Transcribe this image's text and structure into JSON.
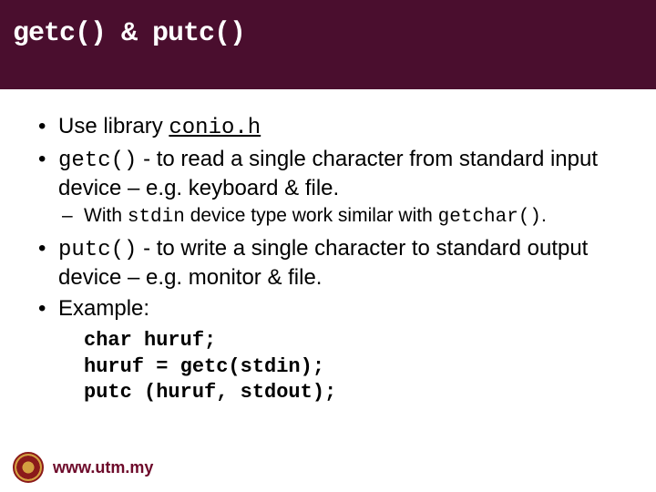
{
  "title": "getc() & putc()",
  "bullets": {
    "b1": {
      "pre": "Use library ",
      "code": "conio.h"
    },
    "b2": {
      "code": "getc()",
      "post": " - to read a single character from standard input device – e.g. keyboard & file."
    },
    "b2sub": {
      "pre": "With ",
      "code1": "stdin",
      "mid": " device type work similar with ",
      "code2": "getchar()",
      "post": "."
    },
    "b3": {
      "code": "putc()",
      "post": " - to write a single character to standard output device – e.g. monitor & file."
    },
    "b4": {
      "text": "Example:"
    }
  },
  "code_example": {
    "l1": "char huruf;",
    "l2": "huruf = getc(stdin);",
    "l3": "putc (huruf, stdout);"
  },
  "footer": {
    "url": "www.utm.my"
  }
}
